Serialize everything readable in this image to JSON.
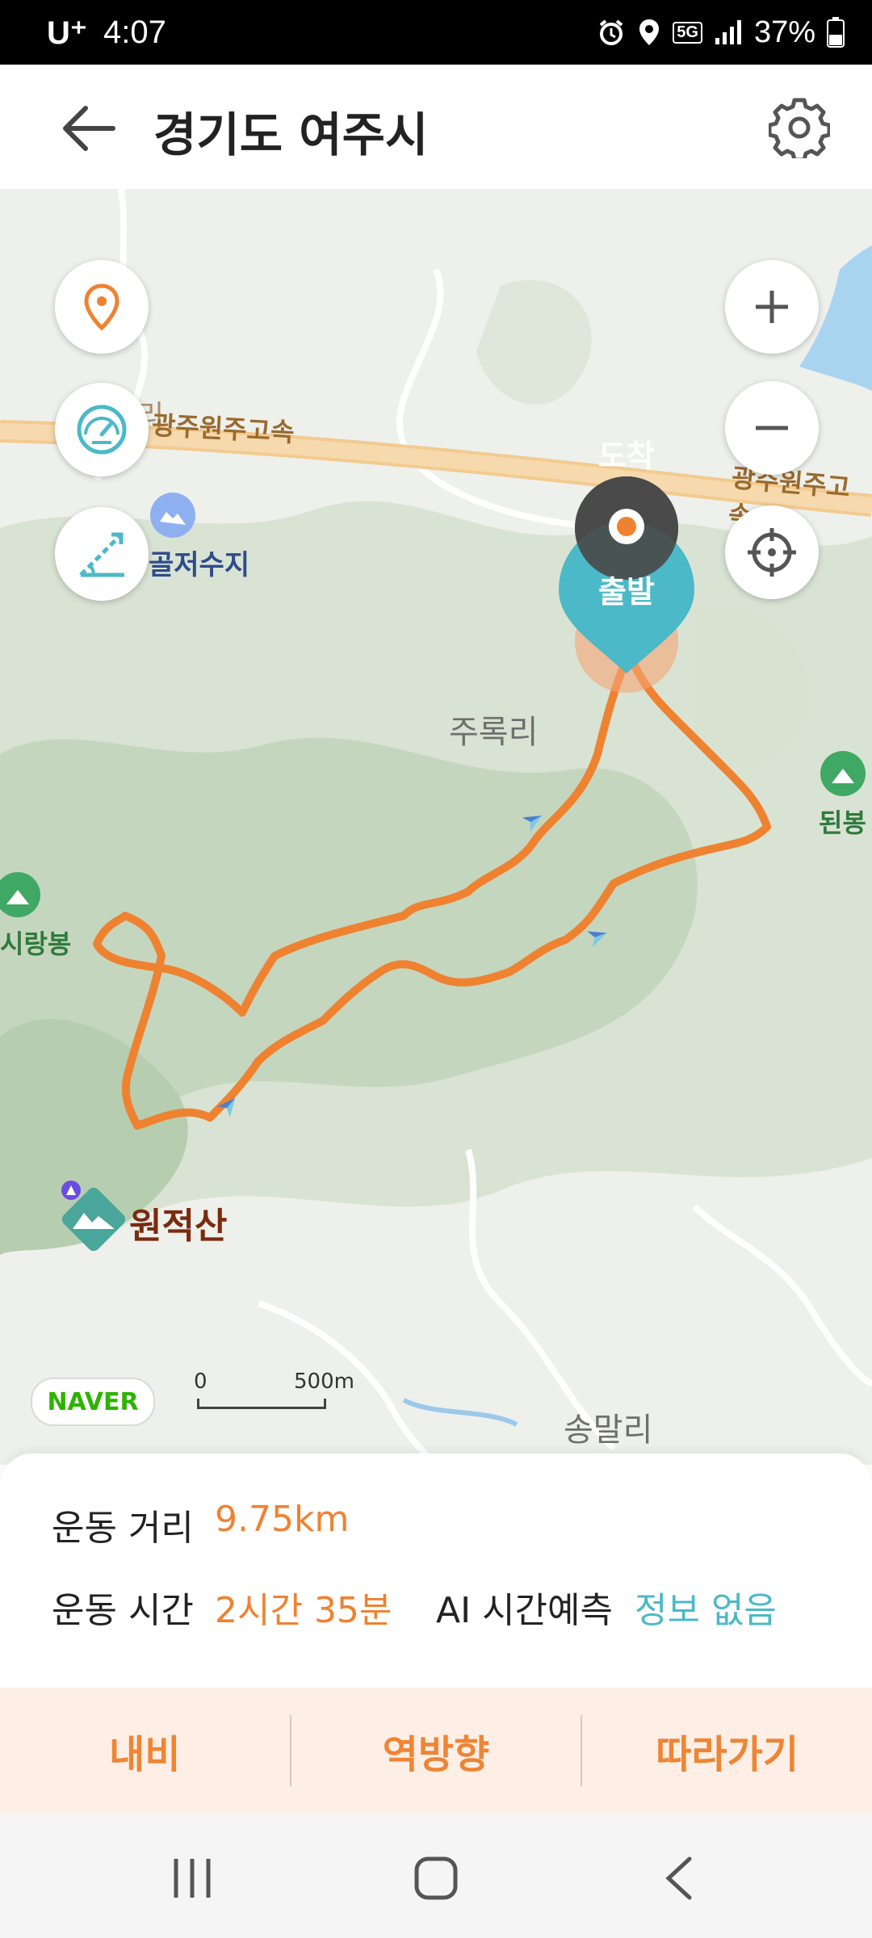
{
  "status_bar": {
    "carrier": "U⁺",
    "time": "4:07",
    "network": "5G",
    "battery": "37%"
  },
  "header": {
    "title": "경기도 여주시",
    "back_icon": "arrow-left-icon",
    "settings_icon": "gear-icon"
  },
  "map": {
    "labels": {
      "highway_left": "광주원주고속",
      "highway_right": "광주원주고속",
      "reservoir": "골저수지",
      "village_1": "주록리",
      "village_2": "송말리",
      "peak_left": "시랑봉",
      "peak_right": "된봉",
      "mountain": "원적산",
      "village_fragment": "리"
    },
    "markers": {
      "finish": "도착",
      "start": "출발"
    },
    "naver": "NAVER",
    "scale_zero": "0",
    "scale_value": "500m",
    "buttons": {
      "location": "location-pin-icon",
      "speed": "speedometer-icon",
      "slope": "slope-icon",
      "zoom_in": "plus-icon",
      "zoom_out": "minus-icon",
      "my_location": "crosshair-icon"
    },
    "colors": {
      "route": "#ef8231",
      "start_marker": "#4bb9c7",
      "finish_marker": "#4a4a4a"
    }
  },
  "stats": {
    "distance_label": "운동 거리",
    "distance_value": "9.75km",
    "time_label": "운동 시간",
    "time_value": "2시간 35분",
    "ai_label": "AI 시간예측",
    "ai_value": "정보 없음"
  },
  "actions": {
    "navigate": "내비",
    "reverse": "역방향",
    "follow": "따라가기"
  },
  "nav_bar": {
    "recents": "recents-icon",
    "home": "home-icon",
    "back": "back-icon"
  }
}
